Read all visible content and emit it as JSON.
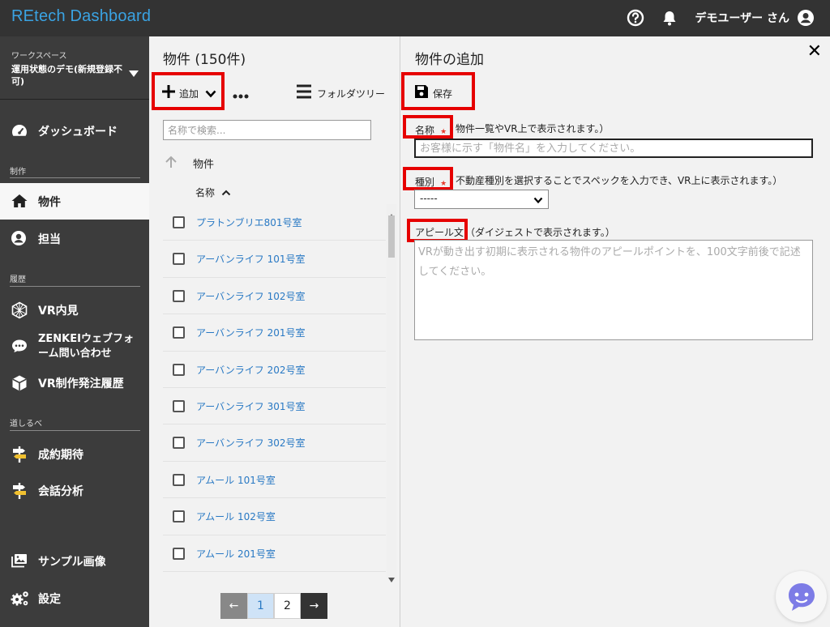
{
  "header": {
    "brand": "REtech Dashboard",
    "help_icon": "help-circle-icon",
    "bell_icon": "bell-icon",
    "user_name": "デモユーザー さん",
    "user_icon": "user-circle-icon",
    "brand_color": "#3aa3e3"
  },
  "sidebar": {
    "workspace_label": "ワークスペース",
    "workspace_name": "運用状態のデモ(新規登録不可)",
    "items": [
      {
        "label": "ダッシュボード",
        "icon": "speedometer-icon"
      },
      {
        "label": "物件",
        "icon": "home-icon"
      },
      {
        "label": "担当",
        "icon": "user-icon"
      },
      {
        "label": "VR内見",
        "icon": "vr-globe-icon"
      },
      {
        "label": "ZENKEIウェブフォーム問い合わせ",
        "icon": "chat-icon"
      },
      {
        "label": "VR制作発注履歴",
        "icon": "cube-icon"
      },
      {
        "label": "成約期待",
        "icon": "signpost-icon"
      },
      {
        "label": "会話分析",
        "icon": "signpost-icon"
      },
      {
        "label": "サンプル画像",
        "icon": "images-icon"
      },
      {
        "label": "設定",
        "icon": "gears-icon"
      }
    ],
    "sections": [
      "制作",
      "履歴",
      "道しるべ"
    ]
  },
  "list_panel": {
    "title": "物件 (150件)",
    "add_label": "追加",
    "folder_tree_label": "フォルダツリー",
    "search_placeholder": "名称で検索...",
    "breadcrumb": "物件",
    "column_header": "名称",
    "rows": [
      "プラトンブリエ801号室",
      "アーバンライフ 101号室",
      "アーバンライフ 102号室",
      "アーバンライフ 201号室",
      "アーバンライフ 202号室",
      "アーバンライフ 301号室",
      "アーバンライフ 302号室",
      "アムール 101号室",
      "アムール 102号室",
      "アムール 201号室"
    ],
    "pagination": {
      "prev": "←",
      "pages": [
        "1",
        "2"
      ],
      "current": "1",
      "next": "→"
    }
  },
  "detail": {
    "title": "物件の追加",
    "save_label": "保存",
    "name_label": "名称",
    "name_hint": "物件一覧やVR上で表示されます。）",
    "name_placeholder": "お客様に示す「物件名」を入力してください。",
    "type_label": "種別",
    "type_hint": "不動産種別を選択することでスペックを入力でき、VR上に表示されます。）",
    "type_value": "-----",
    "appeal_label": "アピール文",
    "appeal_hint": "（ダイジェストで表示されます。）",
    "appeal_placeholder": "VRが動き出す初期に表示される物件のアピールポイントを、100文字前後で記述してください。",
    "required_mark": "★"
  },
  "colors": {
    "highlight_box": "#e60000",
    "link": "#2979c4",
    "sidebar_bg": "#3c3c3c",
    "topbar_bg": "#333333"
  }
}
